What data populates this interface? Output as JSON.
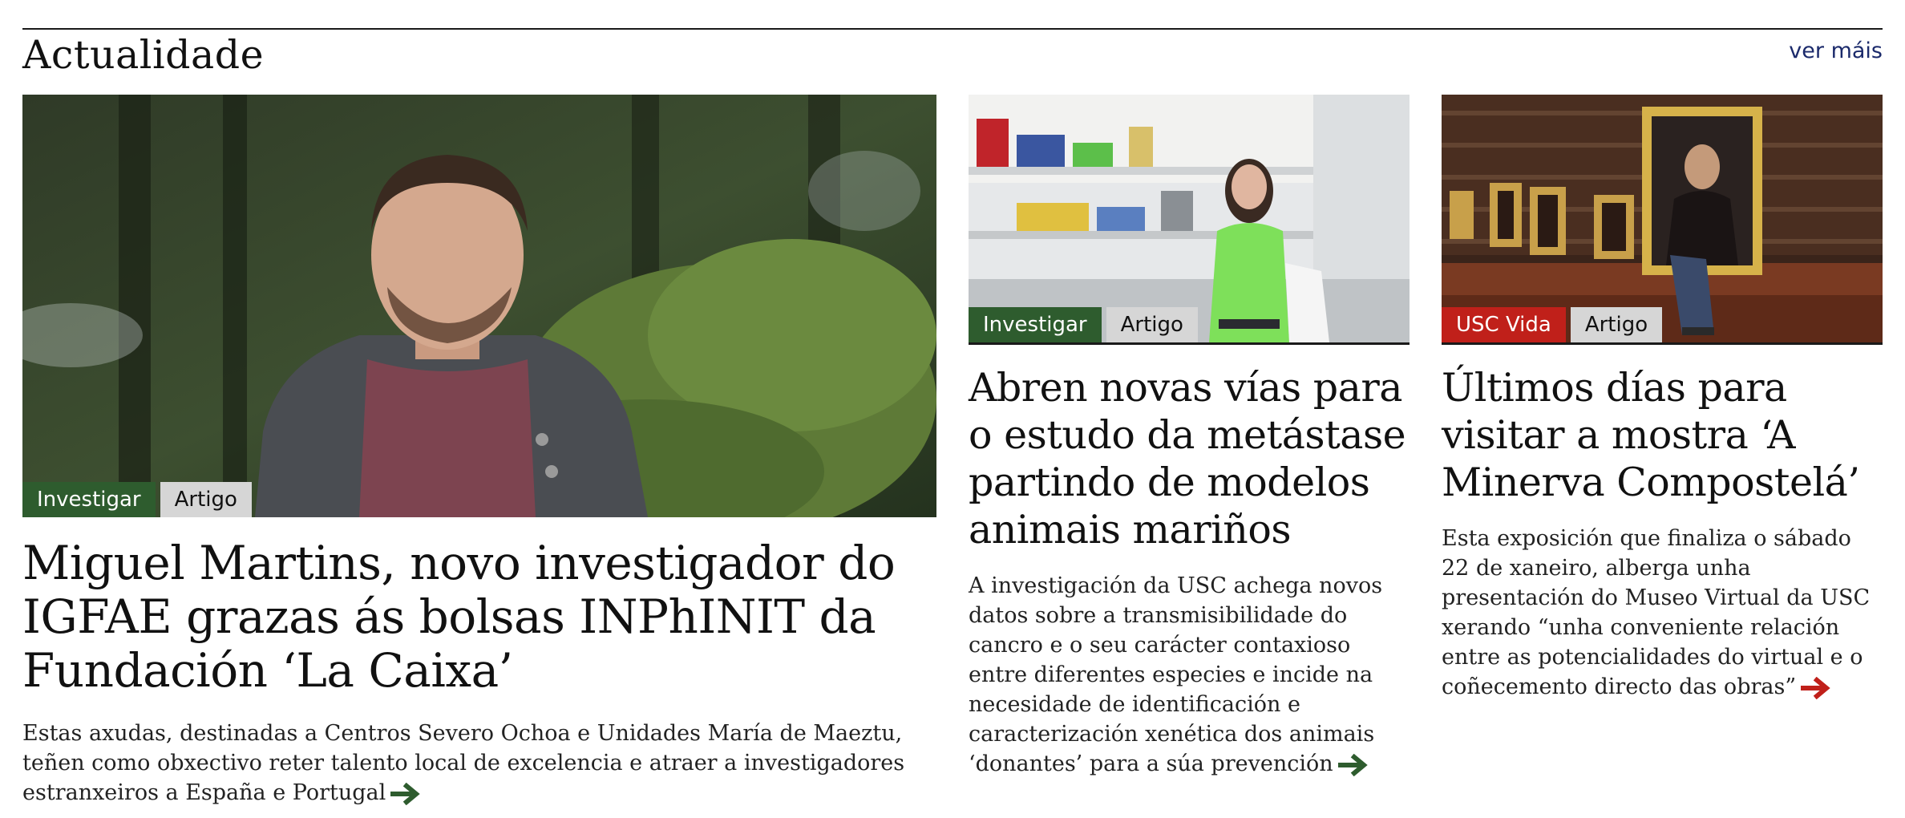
{
  "section": {
    "title": "Actualidade",
    "more_label": "ver máis"
  },
  "colors": {
    "green": "#2e5c2e",
    "red": "#c0201a",
    "grey": "#d6d6d6",
    "link": "#1b2a6b"
  },
  "cards": [
    {
      "tags": [
        "Investigar",
        "Artigo"
      ],
      "headline": "Miguel Martins, novo investigador do IGFAE grazas ás bolsas INPhINIT da Fundación ‘La Caixa’",
      "description": "Estas axudas, destinadas a Centros Severo Ochoa e Unidades María de Maeztu, teñen como obxectivo reter talento local de excelencia e atraer a investigadores estranxeiros a España e Portugal",
      "arrow_icon": "arrow-right-icon"
    },
    {
      "tags": [
        "Investigar",
        "Artigo"
      ],
      "headline": "Abren novas vías para o estudo da metástase partindo de modelos animais mariños",
      "description": "A investigación da USC achega novos datos sobre a transmisibilidade do cancro e o seu carácter contaxioso entre diferentes especies e incide na necesidade de identificación e caracterización xenética dos animais ‘donantes’ para a súa prevención",
      "arrow_icon": "arrow-right-icon"
    },
    {
      "tags": [
        "USC Vida",
        "Artigo"
      ],
      "headline": "Últimos días para visitar a mostra ‘A Minerva Compostelá’",
      "description": "Esta exposición que finaliza o sábado 22 de xaneiro, alberga unha presentación do Museo Virtual da USC xerando “unha conveniente relación entre as potencialidades do virtual e o coñecemento directo das obras”",
      "arrow_icon": "arrow-right-icon"
    }
  ]
}
